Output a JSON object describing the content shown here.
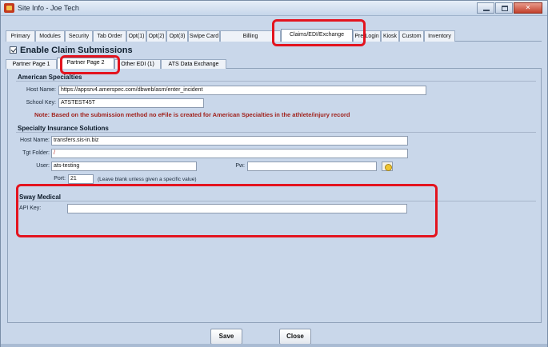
{
  "window": {
    "title": "Site Info - Joe Tech"
  },
  "main_tabs": [
    "Primary",
    "Modules",
    "Security",
    "Tab Order",
    "Opt(1)",
    "Opt(2)",
    "Opt(3)",
    "Swipe Card",
    "Billing",
    "Claims/EDI/Exchange",
    "Pre-Login",
    "Kiosk",
    "Custom",
    "Inventory"
  ],
  "active_main_tab": "Claims/EDI/Exchange",
  "enable_claim_submissions": {
    "label": "Enable Claim Submissions",
    "checked": true
  },
  "sub_tabs": [
    "Partner Page 1",
    "Partner Page 2",
    "Other EDI (1)",
    "ATS Data Exchange"
  ],
  "active_sub_tab": "Partner Page 2",
  "american_specialties": {
    "title": "American Specialties",
    "host_name_label": "Host Name:",
    "host_name_value": "https://appsrv4.amerspec.com/dbweb/asm/enter_incident",
    "school_key_label": "School Key:",
    "school_key_value": "ATSTEST45T",
    "note": "Note:  Based on the submission method no eFile is created for American Specialties in the athlete/injury record"
  },
  "specialty_insurance": {
    "title": "Specialty Insurance Solutions",
    "host_name_label": "Host Name:",
    "host_name_value": "transfers.sis-in.biz",
    "tgt_folder_label": "Tgt Folder:",
    "tgt_folder_value": "/",
    "user_label": "User:",
    "user_value": "ats-testing",
    "pw_label": "Pw:",
    "pw_value": "",
    "port_label": "Port:",
    "port_value": "21",
    "port_hint": "(Leave blank unless given a specific value)"
  },
  "sway_medical": {
    "title": "Sway Medical",
    "api_key_label": "API Key:",
    "api_key_value": ""
  },
  "buttons": {
    "save": "Save",
    "close": "Close"
  },
  "colors": {
    "highlight": "#e3141f",
    "note": "#a0221c",
    "window_bg": "#c9d7ea"
  }
}
